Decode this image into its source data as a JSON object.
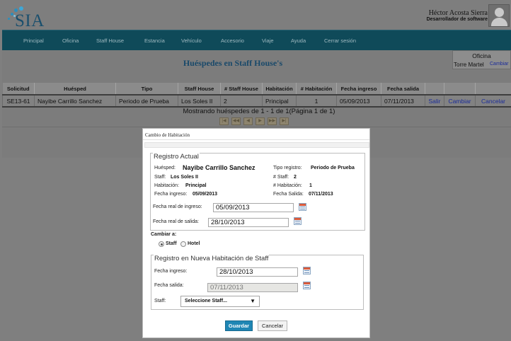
{
  "header": {
    "logo_text": "SIA",
    "user_name": "Héctor Acosta Sierra",
    "user_role": "Desarrollador de software"
  },
  "nav": {
    "items": [
      "Principal",
      "Oficina",
      "Staff House",
      "Estancia",
      "Vehículo",
      "Accesorio",
      "Viaje",
      "Ayuda",
      "Cerrar sesión"
    ]
  },
  "page": {
    "title": "Huéspedes en Staff House's",
    "office": {
      "label": "Oficina",
      "value": "Torre Martel",
      "change_link": "Cambiar"
    }
  },
  "table": {
    "headers": [
      "Solicitud",
      "Huésped",
      "Tipo",
      "Staff House",
      "# Staff House",
      "Habitación",
      "# Habitación",
      "Fecha ingreso",
      "Fecha salida",
      "",
      "",
      ""
    ],
    "rows": [
      {
        "solicitud": "SE13-61",
        "huesped": "Nayibe Carrillo Sanchez",
        "tipo": "Periodo de Prueba",
        "staff_house": "Los Soles II",
        "num_staff_house": "2",
        "habitacion": "Principal",
        "num_habitacion": "1",
        "fecha_ingreso": "05/09/2013",
        "fecha_salida": "07/11/2013",
        "action_salir": "Salir",
        "action_cambiar": "Cambiar",
        "action_cancelar": "Cancelar"
      }
    ],
    "showing_text": "Mostrando huéspedes de 1 - 1 de 1(Página 1 de 1)"
  },
  "modal": {
    "title": "Cambio de Habitación",
    "registro_actual": {
      "legend": "Registro Actual",
      "huesped_label": "Huésped:",
      "huesped_value": "Nayibe Carrillo Sanchez",
      "tipo_registro_label": "Tipo registro:",
      "tipo_registro_value": "Periodo de Prueba",
      "staff_label": "Staff:",
      "staff_value": "Los Soles II",
      "num_staff_label": "# Staff:",
      "num_staff_value": "2",
      "habitacion_label": "Habitación:",
      "habitacion_value": "Principal",
      "num_habitacion_label": "# Habitación:",
      "num_habitacion_value": "1",
      "fecha_ingreso_label": "Fecha ingreso:",
      "fecha_ingreso_value": "05/09/2013",
      "fecha_salida_label": "Fecha Salida:",
      "fecha_salida_value": "07/11/2013",
      "fecha_real_ingreso_label": "Fecha real de ingreso:",
      "fecha_real_ingreso_value": "05/09/2013",
      "fecha_real_salida_label": "Fecha real de salida:",
      "fecha_real_salida_value": "28/10/2013"
    },
    "cambiar_a": {
      "label": "Cambiar a:",
      "option_staff": "Staff",
      "option_hotel": "Hotel",
      "selected": "Staff"
    },
    "nueva_habitacion": {
      "legend": "Registro en Nueva Habitación de Staff",
      "fecha_ingreso_label": "Fecha ingreso:",
      "fecha_ingreso_value": "28/10/2013",
      "fecha_salida_label": "Fecha salida:",
      "fecha_salida_value": "07/11/2013",
      "staff_label": "Staff:",
      "staff_select_value": "Seleccione Staff..."
    },
    "buttons": {
      "save": "Guardar",
      "cancel": "Cancelar"
    }
  }
}
